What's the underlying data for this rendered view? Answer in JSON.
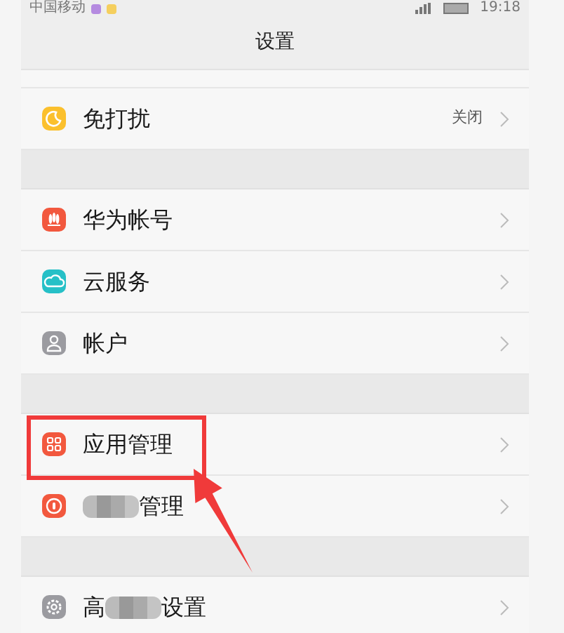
{
  "status_bar": {
    "carrier": "中国移动",
    "time": "19:18"
  },
  "title": "设置",
  "groups": [
    {
      "items": [
        {
          "parts": [
            {
              "kind": "text",
              "text": "免打扰"
            }
          ],
          "value": "关闭",
          "highlighted": false
        }
      ]
    },
    {
      "items": [
        {
          "parts": [
            {
              "kind": "text",
              "text": "华为帐号"
            }
          ],
          "highlighted": false
        },
        {
          "parts": [
            {
              "kind": "text",
              "text": "云服务"
            }
          ],
          "highlighted": false
        },
        {
          "parts": [
            {
              "kind": "text",
              "text": "帐户"
            }
          ],
          "highlighted": false
        }
      ]
    },
    {
      "items": [
        {
          "parts": [
            {
              "kind": "text",
              "text": "应用管理"
            }
          ],
          "highlighted": true
        },
        {
          "parts": [
            {
              "kind": "mosaic"
            },
            {
              "kind": "text",
              "text": "管理"
            }
          ],
          "highlighted": false
        }
      ]
    },
    {
      "items": [
        {
          "parts": [
            {
              "kind": "text",
              "text": "高"
            },
            {
              "kind": "mosaic"
            },
            {
              "kind": "text",
              "text": "设置"
            }
          ],
          "highlighted": false
        }
      ]
    }
  ]
}
